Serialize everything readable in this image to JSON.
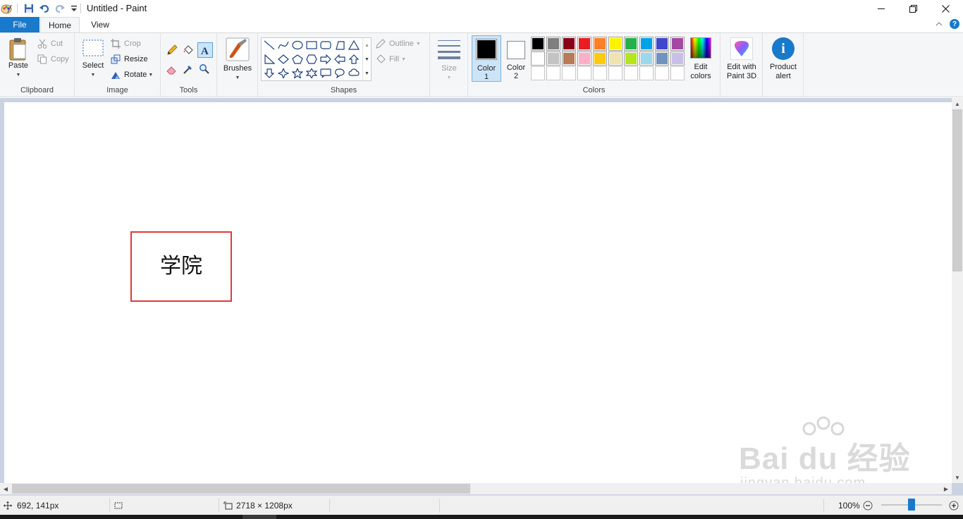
{
  "window": {
    "title": "Untitled - Paint"
  },
  "tabs": {
    "file": "File",
    "home": "Home",
    "view": "View"
  },
  "clipboard": {
    "paste": "Paste",
    "cut": "Cut",
    "copy": "Copy",
    "label": "Clipboard"
  },
  "image": {
    "select": "Select",
    "crop": "Crop",
    "resize": "Resize",
    "rotate": "Rotate",
    "label": "Image"
  },
  "tools": {
    "label": "Tools"
  },
  "brushes": {
    "label": "Brushes"
  },
  "shapes": {
    "outline": "Outline",
    "fill": "Fill",
    "label": "Shapes"
  },
  "size": {
    "label": "Size"
  },
  "colors": {
    "color1_line1": "Color",
    "color1_line2": "1",
    "color2_line1": "Color",
    "color2_line2": "2",
    "edit_line1": "Edit",
    "edit_line2": "colors",
    "label": "Colors",
    "color1_value": "#000000",
    "color2_value": "#ffffff",
    "palette_row1": [
      "#000000",
      "#7f7f7f",
      "#880015",
      "#ed1c24",
      "#ff7f27",
      "#fff200",
      "#22b14c",
      "#00a2e8",
      "#3f48cc",
      "#a349a4"
    ],
    "palette_row2": [
      "#ffffff",
      "#c3c3c3",
      "#b97a57",
      "#ffaec9",
      "#ffc90e",
      "#efe4b0",
      "#b5e61d",
      "#99d9ea",
      "#7092be",
      "#c8bfe7"
    ]
  },
  "paint3d": {
    "line1": "Edit with",
    "line2": "Paint 3D"
  },
  "product_alert": {
    "line1": "Product",
    "line2": "alert"
  },
  "canvas": {
    "text": "学院",
    "box_color": "#e0393b"
  },
  "status": {
    "cursor_pos": "692, 141px",
    "image_size": "2718 × 1208px",
    "zoom": "100%",
    "zoom_level_percent": 100
  },
  "watermark": {
    "brand": "Bai  du 经验",
    "url": "jingyan.baidu.com"
  }
}
